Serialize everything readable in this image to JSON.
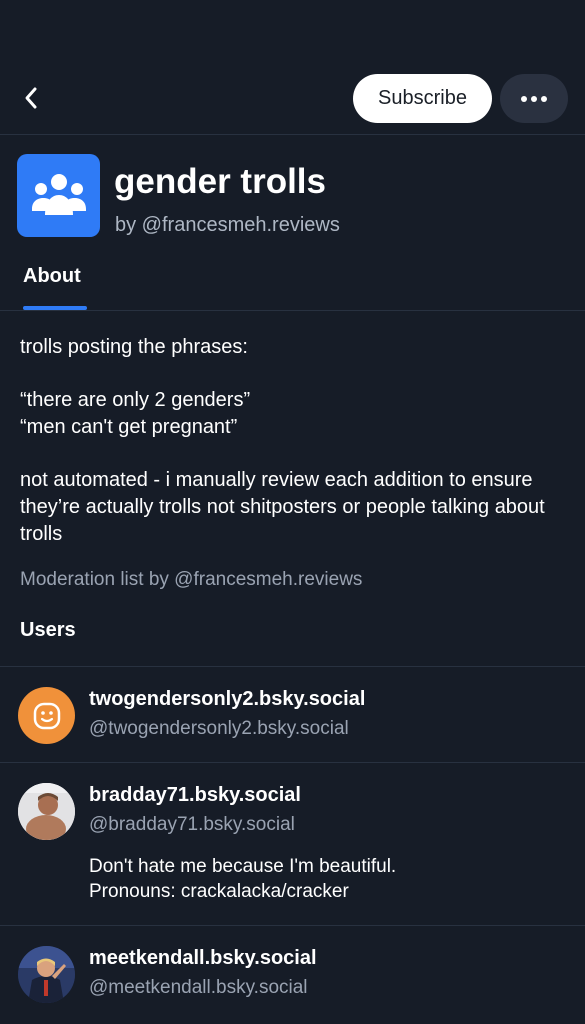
{
  "header": {
    "subscribe_label": "Subscribe"
  },
  "list": {
    "title": "gender trolls",
    "owner": "by @francesmeh.reviews",
    "tab_about": "About",
    "description": {
      "line1": "trolls posting the phrases:",
      "line2": "“there are only 2 genders”",
      "line3": "“men can't get pregnant”",
      "line4": "not automated - i manually review each addition to ensure they’re actually trolls not shitposters or people talking about trolls"
    },
    "credit": "Moderation list by @francesmeh.reviews",
    "users_heading": "Users"
  },
  "users": [
    {
      "display_name": "twogendersonly2.bsky.social",
      "handle": "@twogendersonly2.bsky.social",
      "avatar_color": "#f0913a",
      "avatar_icon": "smiley-icon"
    },
    {
      "display_name": "bradday71.bsky.social",
      "handle": "@bradday71.bsky.social",
      "bio_line1": "Don't hate me because I'm beautiful.",
      "bio_line2": "Pronouns: crackalacka/cracker",
      "avatar_icon": "photo-avatar"
    },
    {
      "display_name": "meetkendall.bsky.social",
      "handle": "@meetkendall.bsky.social",
      "avatar_icon": "photo-avatar"
    }
  ],
  "colors": {
    "background": "#161c27",
    "accent": "#2f7bf6",
    "muted_text": "#9aa3b2",
    "divider": "#283140"
  }
}
